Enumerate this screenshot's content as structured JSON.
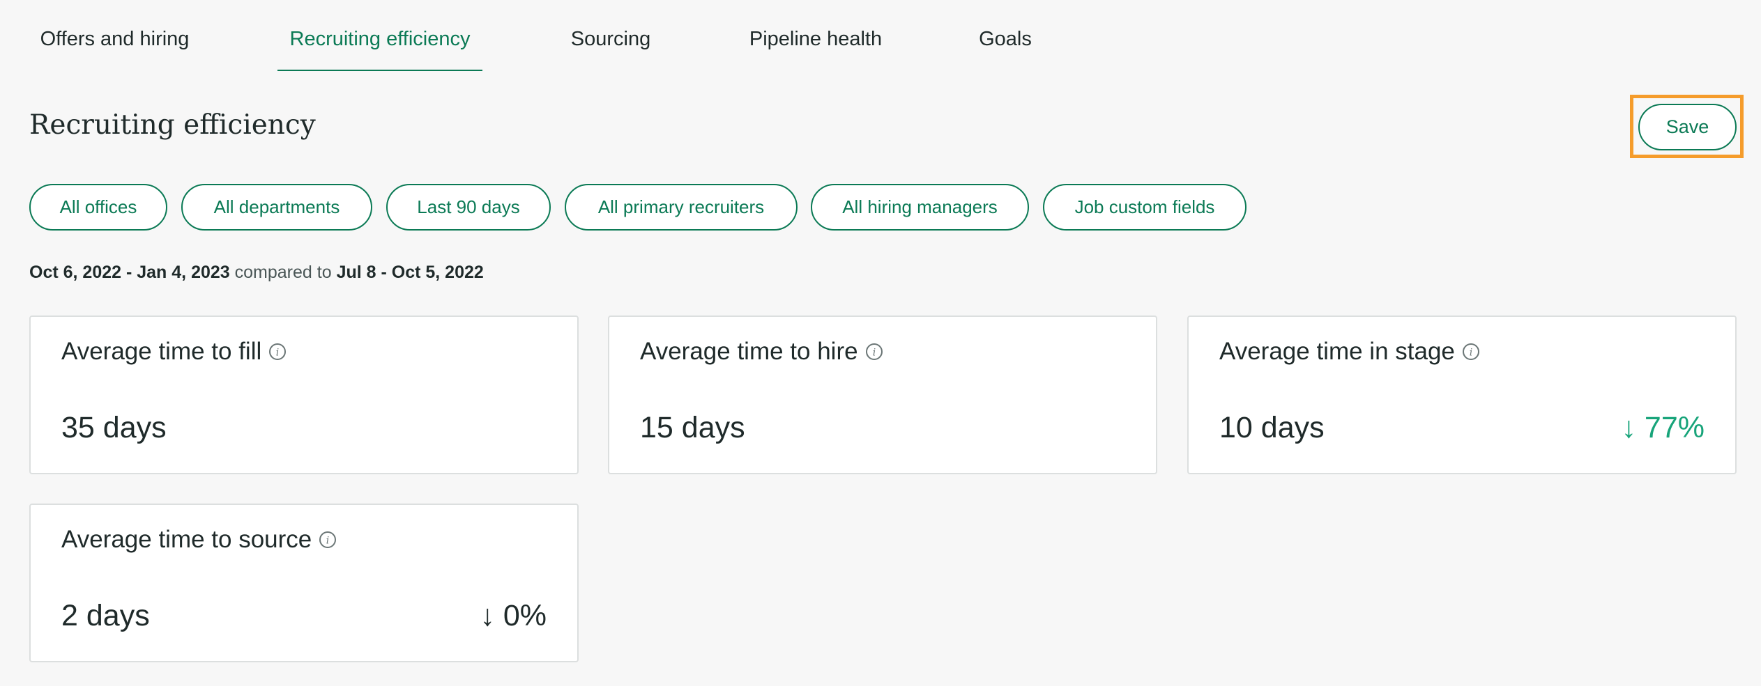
{
  "tabs": [
    {
      "label": "Offers and hiring",
      "active": false
    },
    {
      "label": "Recruiting efficiency",
      "active": true
    },
    {
      "label": "Sourcing",
      "active": false
    },
    {
      "label": "Pipeline health",
      "active": false
    },
    {
      "label": "Goals",
      "active": false
    }
  ],
  "page": {
    "title": "Recruiting efficiency",
    "save_label": "Save"
  },
  "filters": [
    "All offices",
    "All departments",
    "Last 90 days",
    "All primary recruiters",
    "All hiring managers",
    "Job custom fields"
  ],
  "date_range": {
    "current": "Oct 6, 2022 - Jan 4, 2023",
    "compared_text": "compared to",
    "previous": "Jul 8 - Oct 5, 2022"
  },
  "metrics": [
    {
      "title": "Average time to fill",
      "value": "35 days",
      "change": ""
    },
    {
      "title": "Average time to hire",
      "value": "15 days",
      "change": ""
    },
    {
      "title": "Average time in stage",
      "value": "10 days",
      "change": "↓ 77%"
    },
    {
      "title": "Average time to source",
      "value": "2 days",
      "change": "↓ 0%"
    }
  ],
  "colors": {
    "accent": "#0b7a55",
    "positive_change": "#18a47a",
    "highlight_outline": "#f59c2b",
    "background": "#f7f7f7"
  },
  "icons": {
    "info": "info-icon",
    "arrow_down": "arrow-down-icon"
  }
}
